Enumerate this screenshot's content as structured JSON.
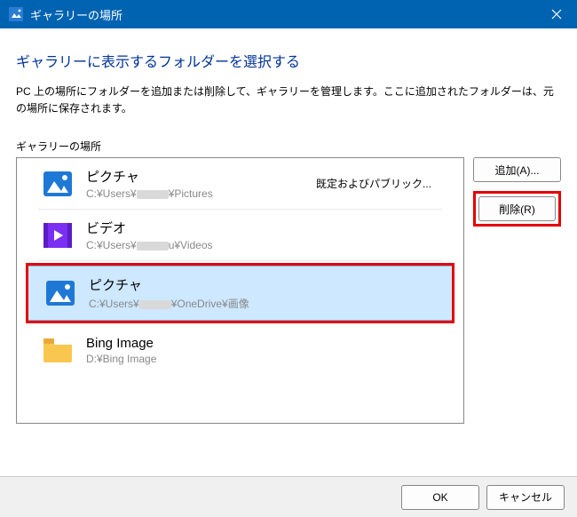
{
  "titlebar": {
    "title": "ギャラリーの場所"
  },
  "heading": "ギャラリーに表示するフォルダーを選択する",
  "description": "PC 上の場所にフォルダーを追加または削除して、ギャラリーを管理します。ここに追加されたフォルダーは、元の場所に保存されます。",
  "list_label": "ギャラリーの場所",
  "buttons": {
    "add": "追加(A)...",
    "remove": "削除(R)",
    "ok": "OK",
    "cancel": "キャンセル"
  },
  "folders": [
    {
      "name": "ピクチャ",
      "path_prefix": "C:¥Users¥",
      "path_suffix": "¥Pictures",
      "note": "既定およびパブリック...",
      "icon": "pictures-icon",
      "selected": false
    },
    {
      "name": "ビデオ",
      "path_prefix": "C:¥Users¥",
      "path_suffix": "u¥Videos",
      "note": "",
      "icon": "video-icon",
      "selected": false
    },
    {
      "name": "ピクチャ",
      "path_prefix": "C:¥Users¥",
      "path_suffix": "¥OneDrive¥画像",
      "note": "",
      "icon": "pictures-icon",
      "selected": true
    },
    {
      "name": "Bing Image",
      "path_prefix": "D:¥Bing Image",
      "path_suffix": "",
      "note": "",
      "icon": "folder-icon",
      "selected": false,
      "no_redact": true
    }
  ]
}
